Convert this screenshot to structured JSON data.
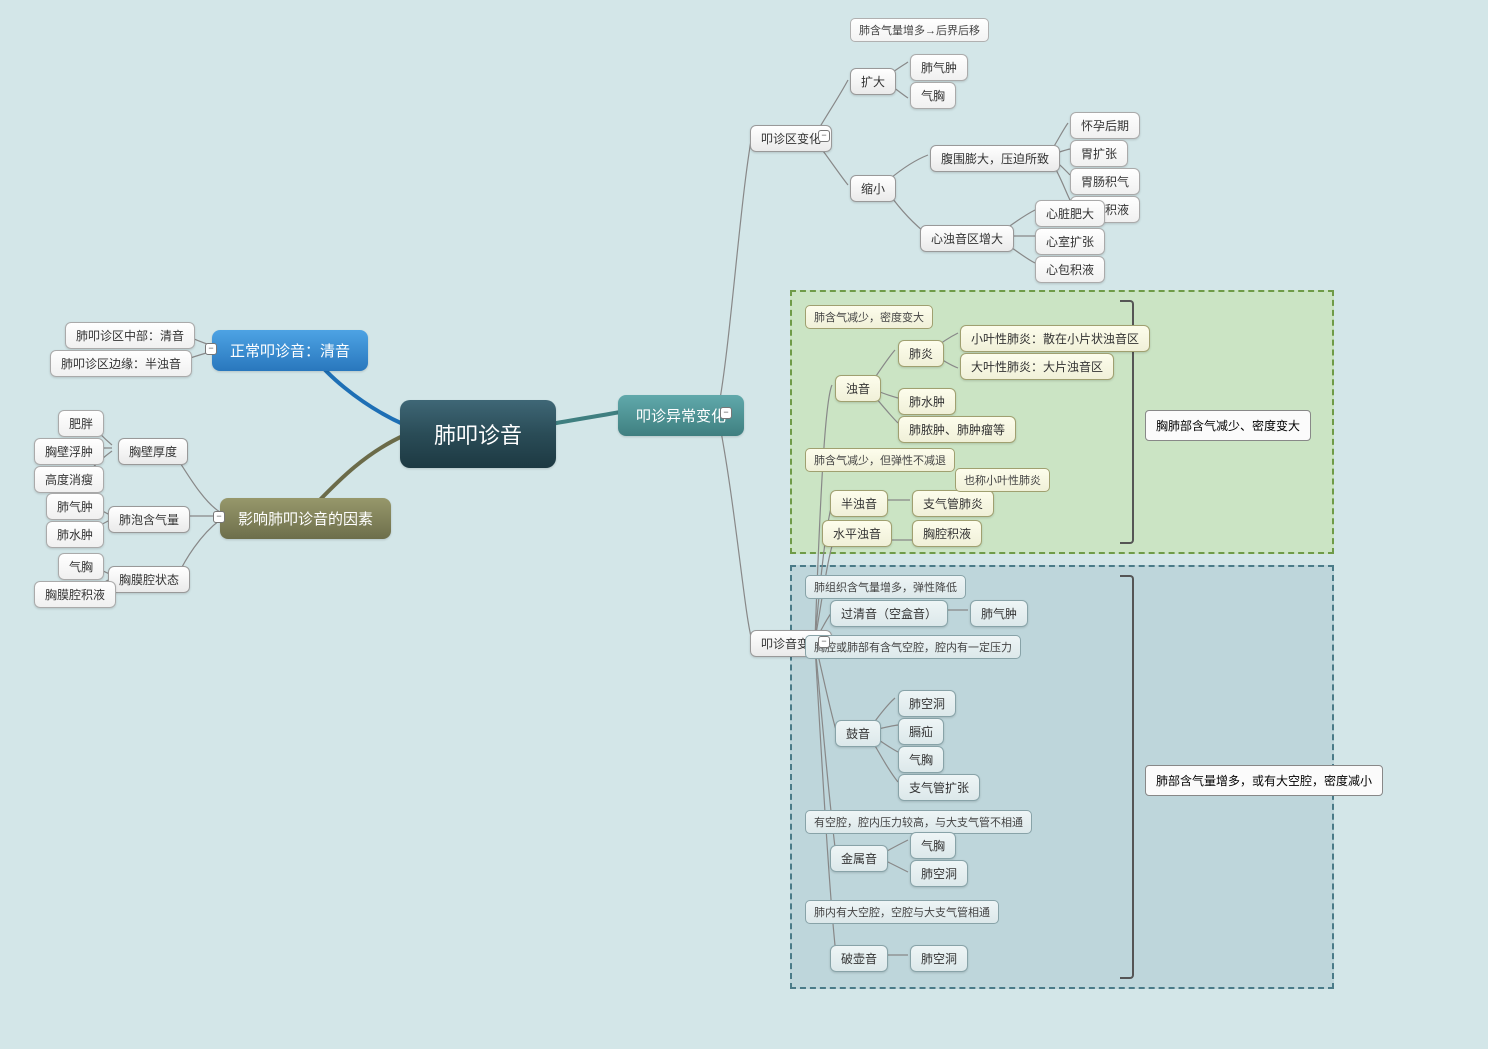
{
  "root": "肺叩诊音",
  "left": {
    "normal": {
      "title": "正常叩诊音：清音",
      "items": [
        "肺叩诊区中部：清音",
        "肺叩诊区边缘：半浊音"
      ]
    },
    "factors": {
      "title": "影响肺叩诊音的因素",
      "g1": {
        "title": "胸壁厚度",
        "items": [
          "肥胖",
          "胸壁浮肿",
          "高度消瘦"
        ]
      },
      "g2": {
        "title": "肺泡含气量",
        "items": [
          "肺气肿",
          "肺水肿"
        ]
      },
      "g3": {
        "title": "胸膜腔状态",
        "items": [
          "气胸",
          "胸膜腔积液"
        ]
      }
    }
  },
  "right": {
    "title": "叩诊异常变化",
    "area": {
      "title": "叩诊区变化",
      "big": {
        "title": "扩大",
        "desc": "肺含气量增多→后界后移",
        "items": [
          "肺气肿",
          "气胸"
        ]
      },
      "small": {
        "title": "缩小",
        "g1": {
          "title": "腹围膨大，压迫所致",
          "items": [
            "怀孕后期",
            "胃扩张",
            "胃肠积气",
            "腹腔积液"
          ]
        },
        "g2": {
          "title": "心浊音区增大",
          "items": [
            "心脏肥大",
            "心室扩张",
            "心包积液"
          ]
        }
      }
    },
    "sound": {
      "title": "叩诊音变化",
      "cap1": "胸肺部含气减少、密度变大",
      "cap2": "肺部含气量增多，或有大空腔，密度减小",
      "dull": {
        "title": "浊音",
        "desc": "肺含气减少，密度变大",
        "c1": {
          "title": "肺炎",
          "items": [
            "小叶性肺炎：散在小片状浊音区",
            "大叶性肺炎：大片浊音区"
          ]
        },
        "c2": "肺水肿",
        "c3": "肺脓肿、肺肿瘤等"
      },
      "half": {
        "title": "半浊音",
        "desc": "肺含气减少，但弹性不减退",
        "c": {
          "title": "支气管肺炎",
          "note": "也称小叶性肺炎"
        }
      },
      "flat": {
        "title": "水平浊音",
        "c": "胸腔积液"
      },
      "hyper": {
        "title": "过清音（空盒音）",
        "desc": "肺组织含气量增多，弹性降低",
        "c": "肺气肿"
      },
      "tymp": {
        "title": "鼓音",
        "desc": "胸腔或肺部有含气空腔，腔内有一定压力",
        "items": [
          "肺空洞",
          "膈疝",
          "气胸",
          "支气管扩张"
        ]
      },
      "metal": {
        "title": "金属音",
        "desc": "有空腔，腔内压力较高，与大支气管不相通",
        "items": [
          "气胸",
          "肺空洞"
        ]
      },
      "pot": {
        "title": "破壶音",
        "desc": "肺内有大空腔，空腔与大支气管相通",
        "c": "肺空洞"
      }
    }
  }
}
